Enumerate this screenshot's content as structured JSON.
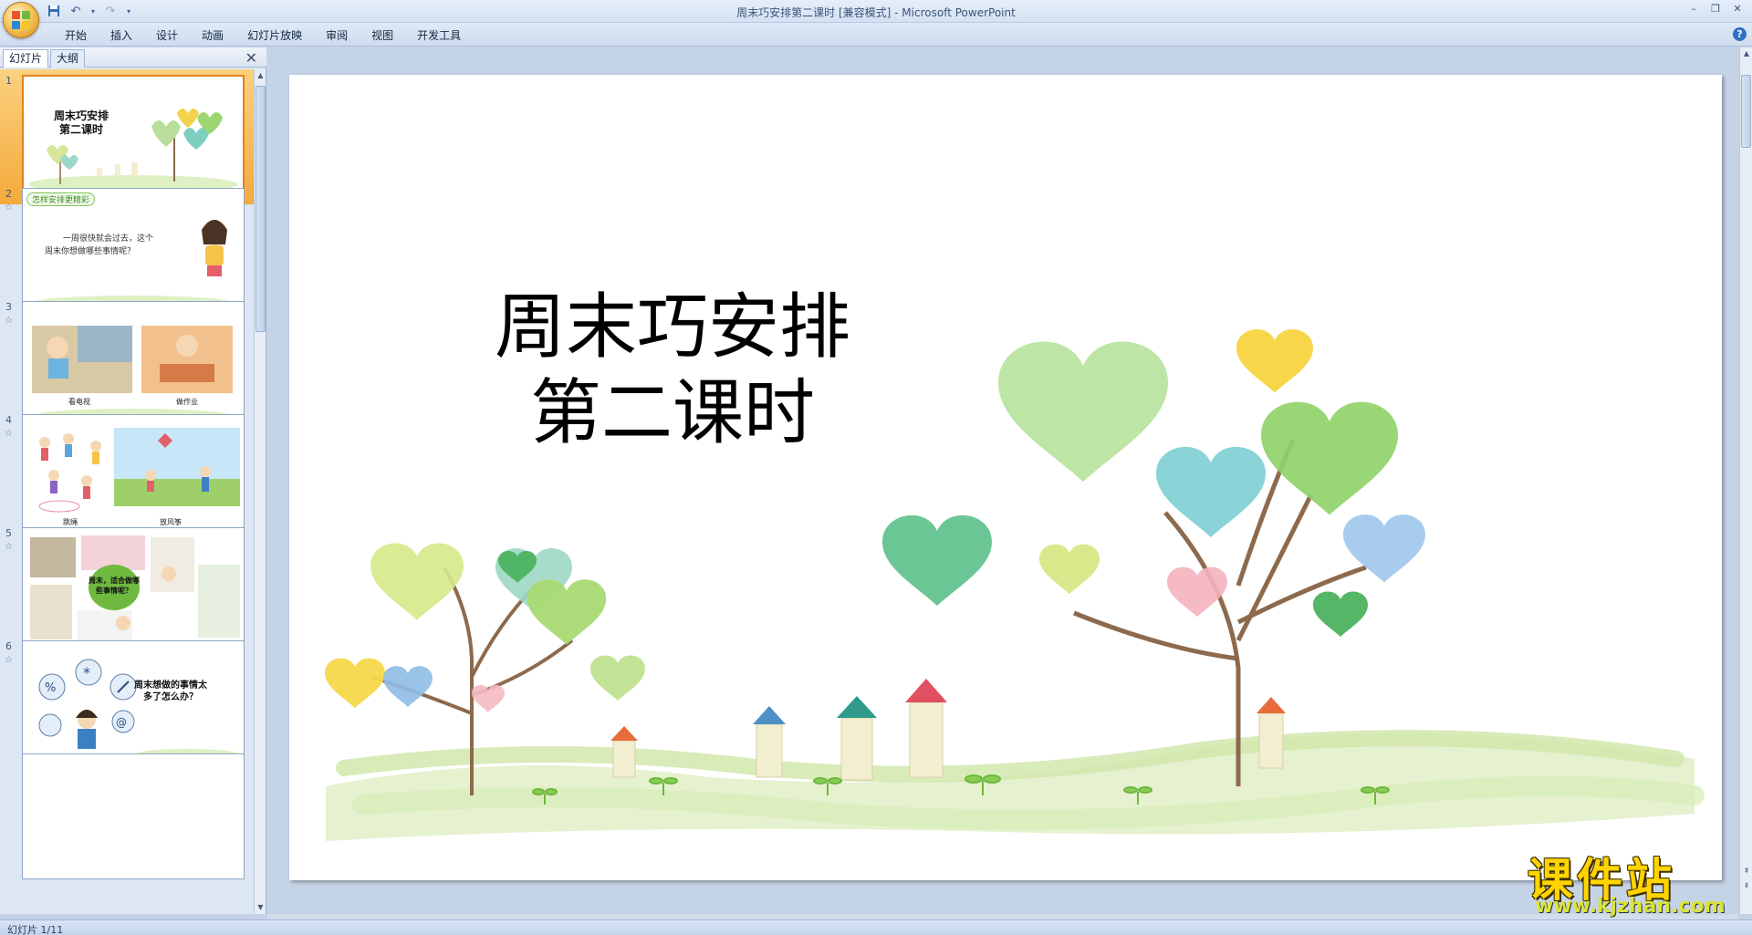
{
  "window": {
    "title": "周末巧安排第二课时 [兼容模式] - Microsoft PowerPoint"
  },
  "qat": {
    "save_icon": "save-icon",
    "undo_icon": "undo-icon",
    "redo_icon": "redo-icon"
  },
  "ribbon": {
    "tabs": [
      {
        "label": "开始"
      },
      {
        "label": "插入"
      },
      {
        "label": "设计"
      },
      {
        "label": "动画"
      },
      {
        "label": "幻灯片放映"
      },
      {
        "label": "审阅"
      },
      {
        "label": "视图"
      },
      {
        "label": "开发工具"
      }
    ]
  },
  "pane": {
    "tab_slides": "幻灯片",
    "tab_outline": "大纲",
    "close_glyph": "✕"
  },
  "thumbnails": [
    {
      "num": "1",
      "title_line1": "周末巧安排",
      "title_line2": "第二课时"
    },
    {
      "num": "2",
      "badge": "怎样安排更精彩",
      "line1": "一周很快就会过去，这个",
      "line2": "周末你想做哪些事情呢？"
    },
    {
      "num": "3",
      "cap1": "看电视",
      "cap2": "做作业"
    },
    {
      "num": "4",
      "cap1": "跳绳",
      "cap2": "放风筝"
    },
    {
      "num": "5",
      "bubble": "周末，适合做哪些事情呢？"
    },
    {
      "num": "6",
      "question": "周末想做的事情太多了怎么办？"
    }
  ],
  "slide": {
    "title_line1": "周末巧安排",
    "title_line2": "第二课时"
  },
  "watermark": {
    "title": "课件站",
    "url": "www.kjzhan.com"
  },
  "status": {
    "slide_info": "幻灯片 1/11"
  },
  "colors": {
    "selection": "#f4a93c",
    "ribbon_bg": "#dfe9f6",
    "workspace_bg": "#c5d3e6"
  }
}
